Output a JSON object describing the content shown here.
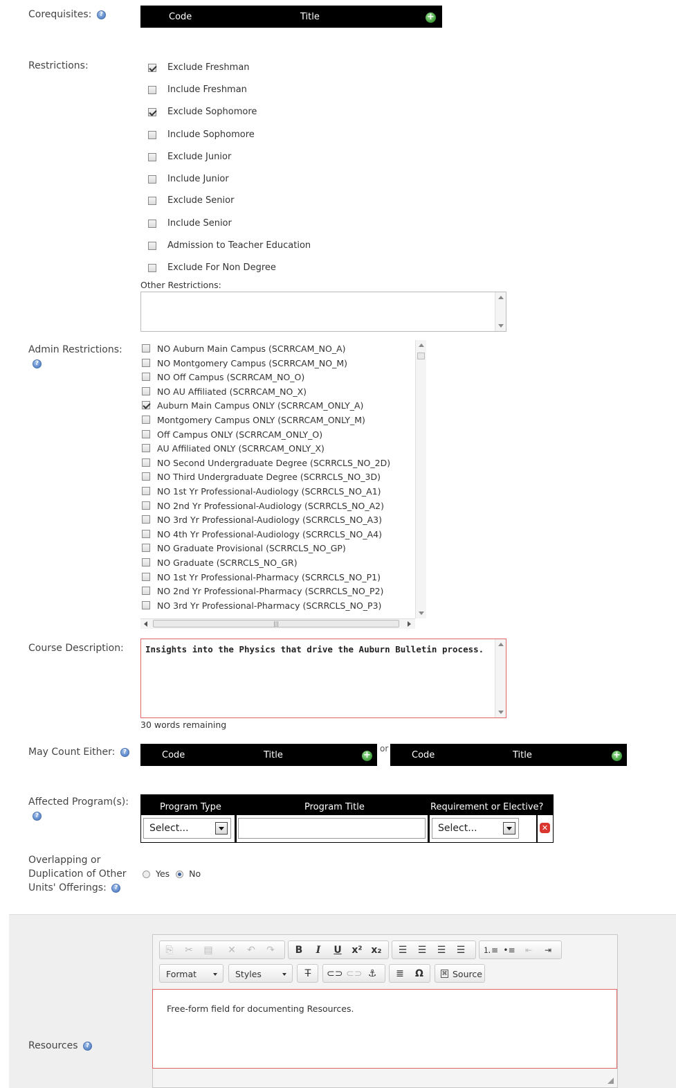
{
  "corequisites": {
    "label": "Corequisites:",
    "col_code": "Code",
    "col_title": "Title",
    "add_icon": "+"
  },
  "restrictions": {
    "label": "Restrictions:",
    "items": [
      {
        "text": "Exclude Freshman",
        "checked": true
      },
      {
        "text": "Include Freshman",
        "checked": false
      },
      {
        "text": "Exclude Sophomore",
        "checked": true
      },
      {
        "text": "Include Sophomore",
        "checked": false
      },
      {
        "text": "Exclude Junior",
        "checked": false
      },
      {
        "text": "Include Junior",
        "checked": false
      },
      {
        "text": "Exclude Senior",
        "checked": false
      },
      {
        "text": "Include Senior",
        "checked": false
      },
      {
        "text": "Admission to Teacher Education",
        "checked": false
      },
      {
        "text": "Exclude For Non Degree",
        "checked": false
      }
    ],
    "other_label": "Other Restrictions:",
    "other_value": ""
  },
  "admin_restrictions": {
    "label": "Admin Restrictions:",
    "items": [
      {
        "text": "NO Auburn Main Campus (SCRRCAM_NO_A)",
        "checked": false
      },
      {
        "text": "NO Montgomery Campus (SCRRCAM_NO_M)",
        "checked": false
      },
      {
        "text": "NO Off Campus (SCRRCAM_NO_O)",
        "checked": false
      },
      {
        "text": "NO AU Affiliated (SCRRCAM_NO_X)",
        "checked": false
      },
      {
        "text": "Auburn Main Campus ONLY (SCRRCAM_ONLY_A)",
        "checked": true
      },
      {
        "text": "Montgomery Campus ONLY (SCRRCAM_ONLY_M)",
        "checked": false
      },
      {
        "text": "Off Campus ONLY (SCRRCAM_ONLY_O)",
        "checked": false
      },
      {
        "text": "AU Affiliated ONLY (SCRRCAM_ONLY_X)",
        "checked": false
      },
      {
        "text": "NO Second Undergraduate Degree (SCRRCLS_NO_2D)",
        "checked": false
      },
      {
        "text": "NO Third Undergraduate Degree (SCRRCLS_NO_3D)",
        "checked": false
      },
      {
        "text": "NO 1st Yr Professional-Audiology (SCRRCLS_NO_A1)",
        "checked": false
      },
      {
        "text": "NO 2nd Yr Professional-Audiology (SCRRCLS_NO_A2)",
        "checked": false
      },
      {
        "text": "NO 3rd Yr Professional-Audiology (SCRRCLS_NO_A3)",
        "checked": false
      },
      {
        "text": "NO 4th Yr Professional-Audiology (SCRRCLS_NO_A4)",
        "checked": false
      },
      {
        "text": "NO Graduate Provisional (SCRRCLS_NO_GP)",
        "checked": false
      },
      {
        "text": "NO Graduate (SCRRCLS_NO_GR)",
        "checked": false
      },
      {
        "text": "NO 1st Yr Professional-Pharmacy (SCRRCLS_NO_P1)",
        "checked": false
      },
      {
        "text": "NO 2nd Yr Professional-Pharmacy (SCRRCLS_NO_P2)",
        "checked": false
      },
      {
        "text": "NO 3rd Yr Professional-Pharmacy (SCRRCLS_NO_P3)",
        "checked": false
      }
    ]
  },
  "course_description": {
    "label": "Course Description:",
    "value": "Insights into the Physics that drive the Auburn Bulletin process.",
    "words_remaining": "30 words remaining"
  },
  "may_count_either": {
    "label": "May Count Either:",
    "col_code": "Code",
    "col_title": "Title",
    "or_text": "or"
  },
  "affected_programs": {
    "label": "Affected Program(s):",
    "col_program_type": "Program Type",
    "col_program_title": "Program Title",
    "col_requirement": "Requirement or Elective?",
    "program_type_value": "Select...",
    "program_title_value": "",
    "requirement_value": "Select..."
  },
  "overlapping": {
    "label_line1": "Overlapping or",
    "label_line2": "Duplication of Other",
    "label_line3": "Units' Offerings:",
    "yes_label": "Yes",
    "no_label": "No",
    "selected": "No"
  },
  "resources": {
    "label": "Resources",
    "format_label": "Format",
    "styles_label": "Styles",
    "source_label": "Source",
    "content": "Free-form field for documenting Resources."
  },
  "colors": {
    "header_bg": "#000000",
    "error_border": "#e06666",
    "add_green": "#3c9a36",
    "remove_red": "#d9362f"
  }
}
